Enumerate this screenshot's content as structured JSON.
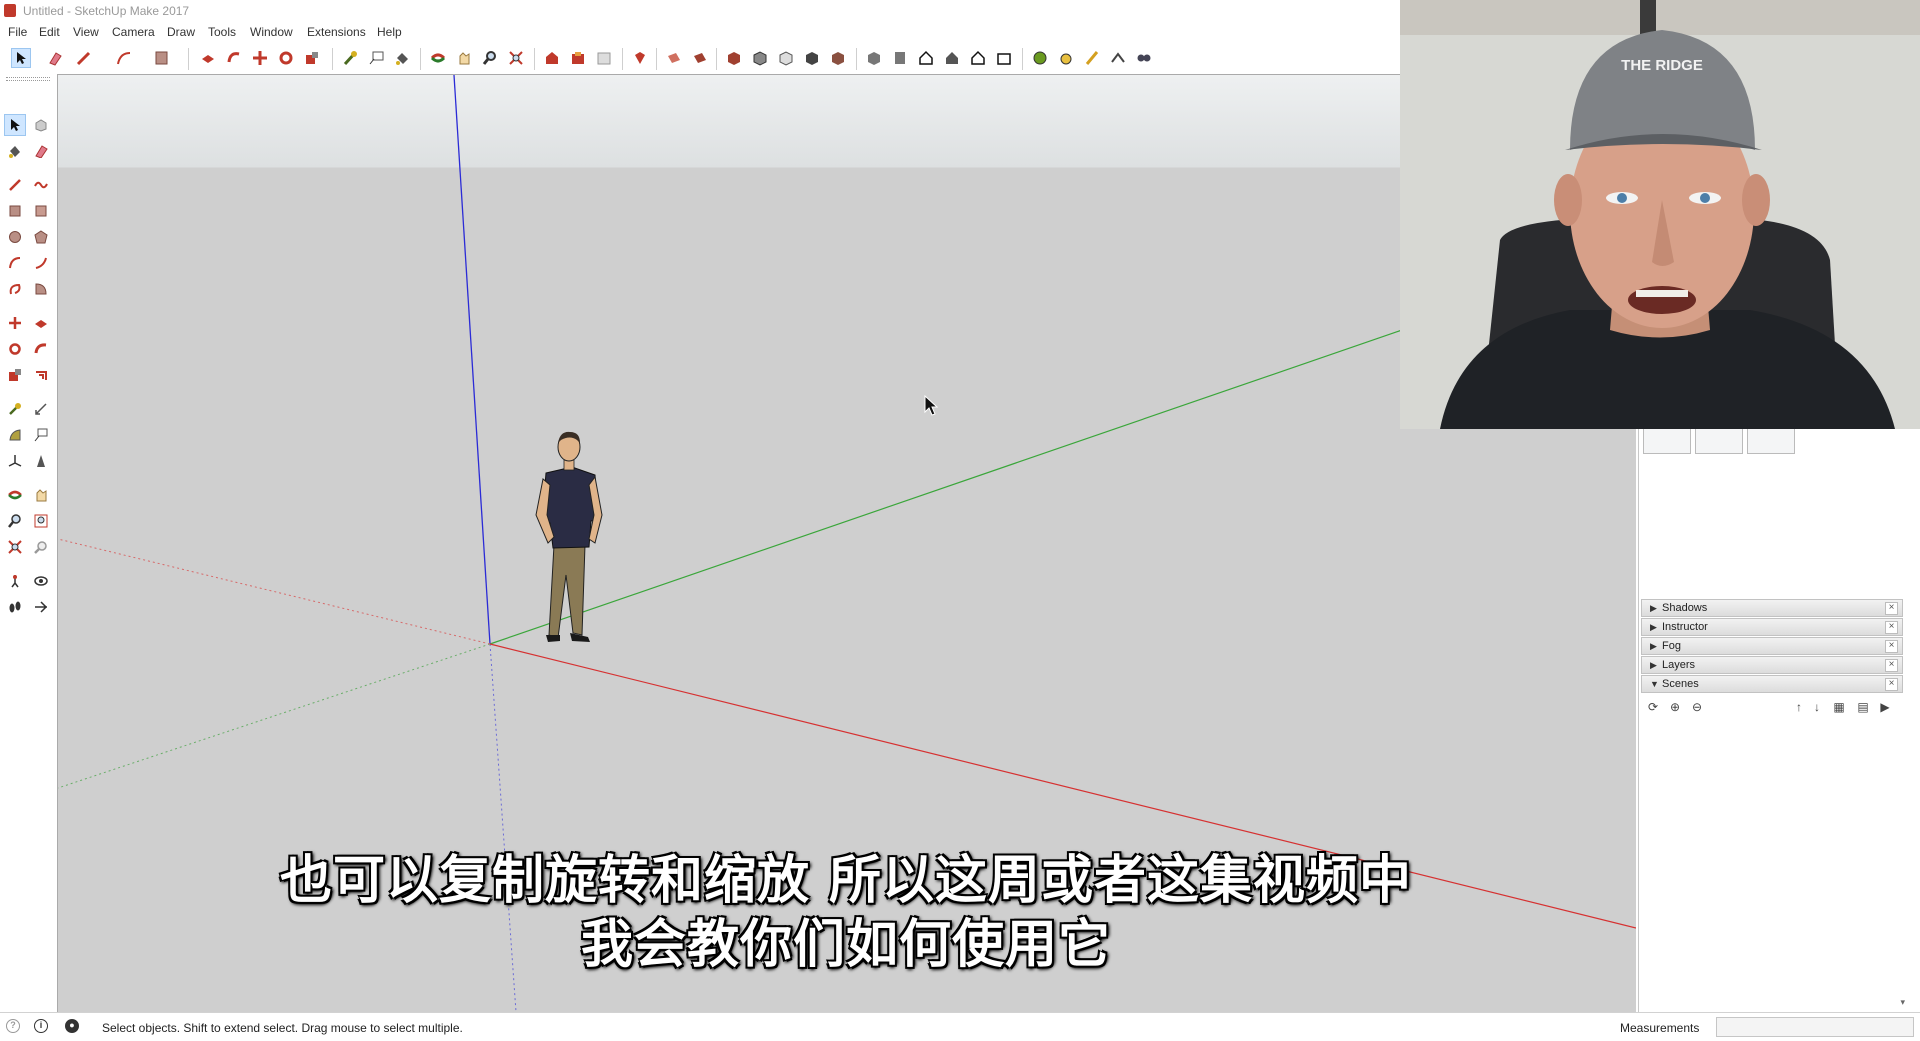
{
  "window": {
    "title": "Untitled - SketchUp Make 2017"
  },
  "menu": [
    "File",
    "Edit",
    "View",
    "Camera",
    "Draw",
    "Tools",
    "Window",
    "Extensions",
    "Help"
  ],
  "toolbar_icons": [
    "select-icon",
    "eraser-icon",
    "line-icon",
    "arc-icon",
    "shape-icon",
    "push-pull-icon",
    "follow-me-icon",
    "move-icon",
    "rotate-icon",
    "scale-icon",
    "tape-measure-icon",
    "text-icon",
    "paint-bucket-icon",
    "orbit-icon",
    "pan-icon",
    "zoom-icon",
    "zoom-extents-icon",
    "warehouse-icon",
    "extension-warehouse-icon",
    "share-model-icon",
    "ruby-icon",
    "section-plane-icon",
    "section-display-icon",
    "iso-view-icon",
    "top-view-icon",
    "front-view-icon",
    "right-view-icon",
    "back-view-icon",
    "left-view-icon",
    "xray-icon",
    "wireframe-icon",
    "hidden-line-icon",
    "shaded-icon",
    "shaded-textures-icon",
    "monochrome-icon",
    "position-camera-icon",
    "walk-icon",
    "look-around-icon",
    "sandbox-icon",
    "solar-north-icon"
  ],
  "palette_icons": [
    "select-icon",
    "component-icon",
    "paint-bucket-icon",
    "eraser-icon",
    "line-icon",
    "freehand-icon",
    "rectangle-icon",
    "rotated-rectangle-icon",
    "circle-icon",
    "polygon-icon",
    "arc-icon",
    "two-point-arc-icon",
    "three-point-arc-icon",
    "pie-icon",
    "move-icon",
    "push-pull-icon",
    "rotate-icon",
    "follow-me-icon",
    "scale-icon",
    "offset-icon",
    "tape-measure-icon",
    "dimension-icon",
    "protractor-icon",
    "text-icon",
    "axes-icon",
    "3d-text-icon",
    "orbit-icon",
    "pan-icon",
    "zoom-icon",
    "zoom-window-icon",
    "zoom-extents-icon",
    "previous-view-icon",
    "position-camera-icon",
    "look-around-icon",
    "walk-icon",
    "section-plane-icon"
  ],
  "tray": {
    "panels": [
      {
        "label": "Shadows",
        "expanded": false
      },
      {
        "label": "Instructor",
        "expanded": false
      },
      {
        "label": "Fog",
        "expanded": false
      },
      {
        "label": "Layers",
        "expanded": false
      },
      {
        "label": "Scenes",
        "expanded": true
      }
    ],
    "close_glyph": "×"
  },
  "subtitles": {
    "line1": "也可以复制旋转和缩放 所以这周或者这集视频中",
    "line2": "我会教你们如何使用它"
  },
  "statusbar": {
    "hint": "Select objects. Shift to extend select. Drag mouse to select multiple.",
    "measurements_label": "Measurements",
    "measurements_value": ""
  },
  "webcam": {
    "cap_text": "THE RIDGE"
  },
  "colors": {
    "axis_blue": "#2b2bd6",
    "axis_green": "#3aa63a",
    "axis_red": "#d63131",
    "ground": "#cfcfcf",
    "sky": "#e6e8e9",
    "selection_highlight": "#cfe6ff"
  }
}
